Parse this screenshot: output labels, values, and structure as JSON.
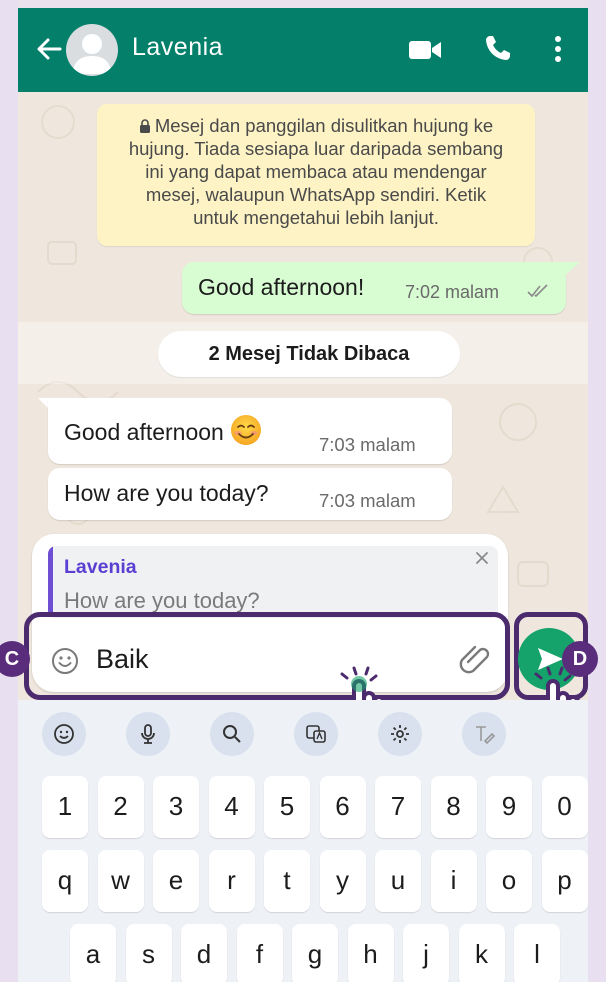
{
  "header": {
    "contact_name": "Lavenia"
  },
  "chat": {
    "encryption_notice": "Mesej dan panggilan disulitkan hujung ke hujung. Tiada sesiapa luar daripada sembang ini yang dapat membaca atau mendengar mesej, walaupun WhatsApp sendiri. Ketik untuk mengetahui lebih lanjut.",
    "encryption_lines": [
      "Mesej dan panggilan disulitkan hujung ke",
      "hujung. Tiada sesiapa luar daripada sembang",
      "ini yang dapat membaca atau mendengar",
      "mesej, walaupun WhatsApp sendiri. Ketik",
      "untuk mengetahui lebih lanjut."
    ],
    "outgoing": {
      "text": "Good afternoon!",
      "time": "7:02 malam"
    },
    "unread_label": "2 Mesej Tidak Dibaca",
    "incoming": [
      {
        "text": "Good afternoon",
        "time": "7:03 malam"
      },
      {
        "text": "How are you today?",
        "time": "7:03 malam"
      }
    ]
  },
  "reply": {
    "name": "Lavenia",
    "text": "How are you today?"
  },
  "input": {
    "value": "Baik"
  },
  "badges": {
    "input": "C",
    "send": "D"
  },
  "keyboard": {
    "toolbar_icons": [
      "emoji-icon",
      "microphone-icon",
      "search-icon",
      "translate-icon",
      "settings-icon",
      "handwriting-icon",
      "more-icon"
    ],
    "row_numbers": [
      "1",
      "2",
      "3",
      "4",
      "5",
      "6",
      "7",
      "8",
      "9",
      "0"
    ],
    "row_top": [
      "q",
      "w",
      "e",
      "r",
      "t",
      "y",
      "u",
      "i",
      "o",
      "p"
    ],
    "row_middle": [
      "a",
      "s",
      "d",
      "f",
      "g",
      "h",
      "j",
      "k",
      "l"
    ]
  },
  "colors": {
    "header": "#04806a",
    "outgoing_bubble": "#d9fdd3",
    "notice": "#fdf3c5",
    "send_button": "#15a36b",
    "highlight_frame": "#4b2a6e"
  }
}
